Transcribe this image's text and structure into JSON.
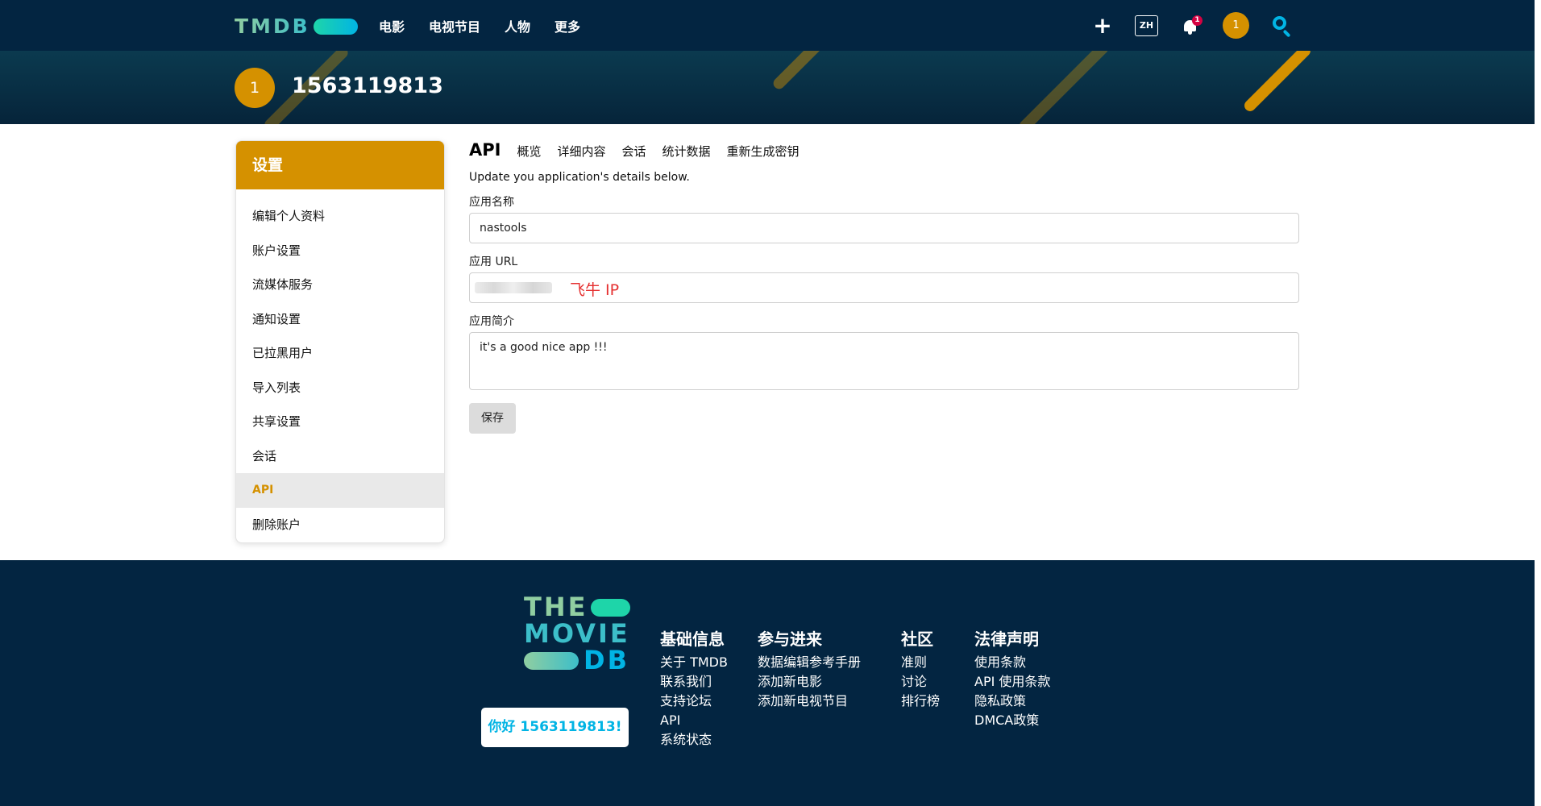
{
  "topnav": {
    "logo_text": "TMDB",
    "links": [
      "电影",
      "电视节目",
      "人物",
      "更多"
    ],
    "lang": "ZH",
    "notification_count": "1",
    "avatar_initial": "1",
    "icons": [
      "plus-icon",
      "bell-icon",
      "search-icon"
    ]
  },
  "banner": {
    "avatar_initial": "1",
    "username": "1563119813"
  },
  "sidebar": {
    "title": "设置",
    "items": [
      "编辑个人资料",
      "账户设置",
      "流媒体服务",
      "通知设置",
      "已拉黑用户",
      "导入列表",
      "共享设置",
      "会话",
      "API",
      "删除账户"
    ],
    "active": "API"
  },
  "main": {
    "tabs": [
      "API",
      "概览",
      "详细内容",
      "会话",
      "统计数据",
      "重新生成密钥"
    ],
    "lead": "Update you application's details below.",
    "app_name_label": "应用名称",
    "app_name_value": "nastools",
    "app_url_label": "应用 URL",
    "app_url_note": "飞牛 IP",
    "app_summary_label": "应用简介",
    "app_summary_value": "it's a good nice app !!!",
    "save_label": "保存"
  },
  "footer": {
    "logo_lines": [
      "THE",
      "MOVIE",
      "DB"
    ],
    "hello_button": "你好 1563119813!",
    "columns": [
      {
        "title": "基础信息",
        "links": [
          "关于 TMDB",
          "联系我们",
          "支持论坛",
          "API",
          "系统状态"
        ]
      },
      {
        "title": "参与进来",
        "links": [
          "数据编辑参考手册",
          "添加新电影",
          "添加新电视节目"
        ]
      },
      {
        "title": "社区",
        "links": [
          "准则",
          "讨论",
          "排行榜"
        ]
      },
      {
        "title": "法律声明",
        "links": [
          "使用条款",
          "API 使用条款",
          "隐私政策",
          "DMCA政策"
        ]
      }
    ]
  },
  "colors": {
    "navy": "#032541",
    "accent": "#d59100",
    "tmdb_blue": "#01b4e4",
    "note_red": "#e53030"
  }
}
